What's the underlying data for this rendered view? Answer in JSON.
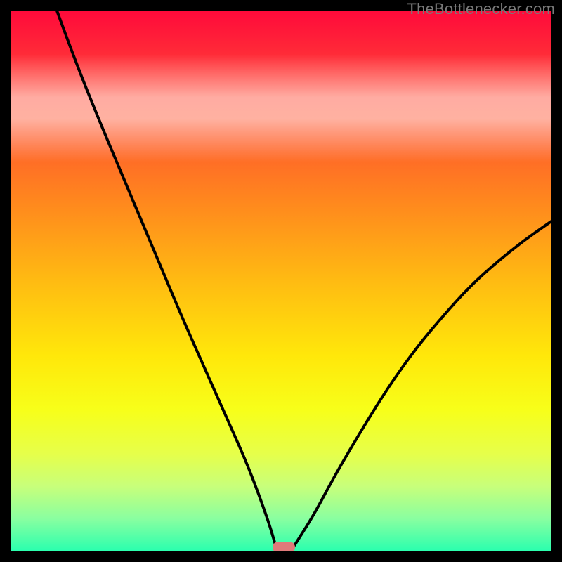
{
  "watermark": "TheBottlenecker.com",
  "chart_data": {
    "type": "line",
    "title": "",
    "xlabel": "",
    "ylabel": "",
    "xlim": [
      0,
      1
    ],
    "ylim": [
      0,
      1
    ],
    "background_gradient": {
      "orientation": "vertical",
      "stops": [
        {
          "pos": 0.0,
          "color": "#ff0a3a"
        },
        {
          "pos": 0.08,
          "color": "#ff2b38"
        },
        {
          "pos": 0.22,
          "color": "#ff5a2c"
        },
        {
          "pos": 0.36,
          "color": "#ff8a1d"
        },
        {
          "pos": 0.5,
          "color": "#ffbb12"
        },
        {
          "pos": 0.64,
          "color": "#ffe80a"
        },
        {
          "pos": 0.74,
          "color": "#f7ff1a"
        },
        {
          "pos": 0.82,
          "color": "#e6ff4a"
        },
        {
          "pos": 0.88,
          "color": "#c8ff7a"
        },
        {
          "pos": 0.94,
          "color": "#8affa0"
        },
        {
          "pos": 1.0,
          "color": "#2bffae"
        }
      ]
    },
    "highlight_band": {
      "y_top": 0.77,
      "y_bottom": 0.87
    },
    "series": [
      {
        "name": "left-branch",
        "x": [
          0.085,
          0.12,
          0.16,
          0.2,
          0.24,
          0.28,
          0.32,
          0.36,
          0.4,
          0.44,
          0.475,
          0.49
        ],
        "y": [
          1.0,
          0.905,
          0.805,
          0.71,
          0.615,
          0.52,
          0.425,
          0.335,
          0.245,
          0.155,
          0.06,
          0.01
        ]
      },
      {
        "name": "right-branch",
        "x": [
          0.525,
          0.56,
          0.6,
          0.65,
          0.7,
          0.75,
          0.8,
          0.85,
          0.9,
          0.95,
          1.0
        ],
        "y": [
          0.01,
          0.065,
          0.14,
          0.225,
          0.305,
          0.375,
          0.435,
          0.49,
          0.535,
          0.575,
          0.61
        ]
      }
    ],
    "marker": {
      "x": 0.505,
      "y": 0.007,
      "color": "#e07a7a"
    }
  }
}
